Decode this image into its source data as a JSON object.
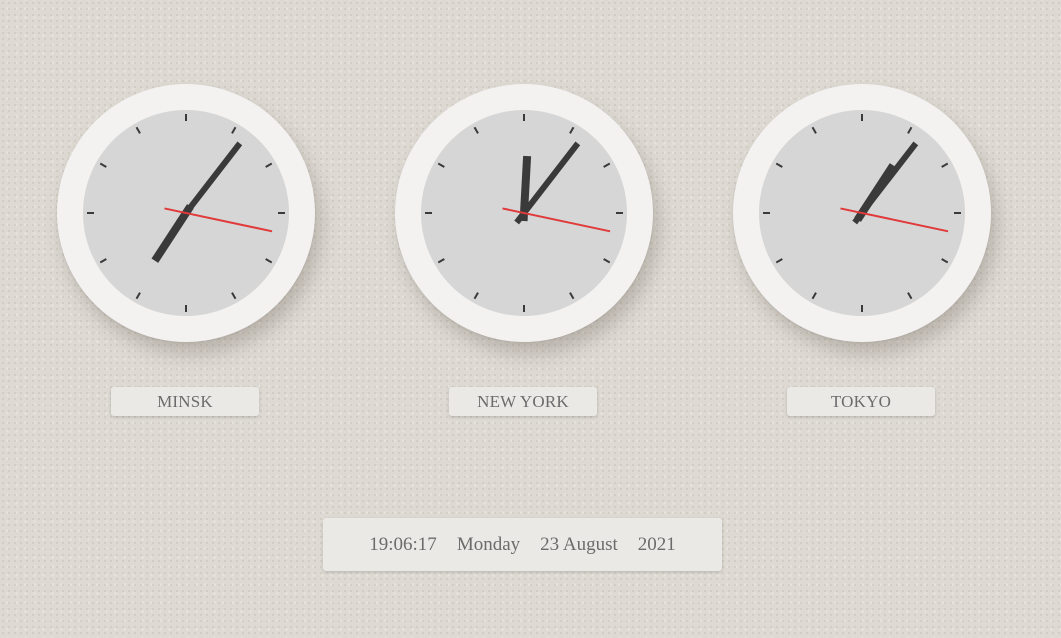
{
  "clocks": [
    {
      "city": "MINSK",
      "hour": 19,
      "minute": 6,
      "second": 17
    },
    {
      "city": "NEW YORK",
      "hour": 12,
      "minute": 6,
      "second": 17
    },
    {
      "city": "TOKYO",
      "hour": 1,
      "minute": 6,
      "second": 17
    }
  ],
  "datetime": {
    "time": "19:06:17",
    "weekday": "Monday",
    "date": "23 August",
    "year": "2021"
  },
  "colors": {
    "background": "#dedad3",
    "clock_rim": "#f3f2f1",
    "dial": "#d6d6d6",
    "hands": "#3a3a3a",
    "second_hand": "#e03a3a",
    "label_text": "#6b6b6b"
  }
}
